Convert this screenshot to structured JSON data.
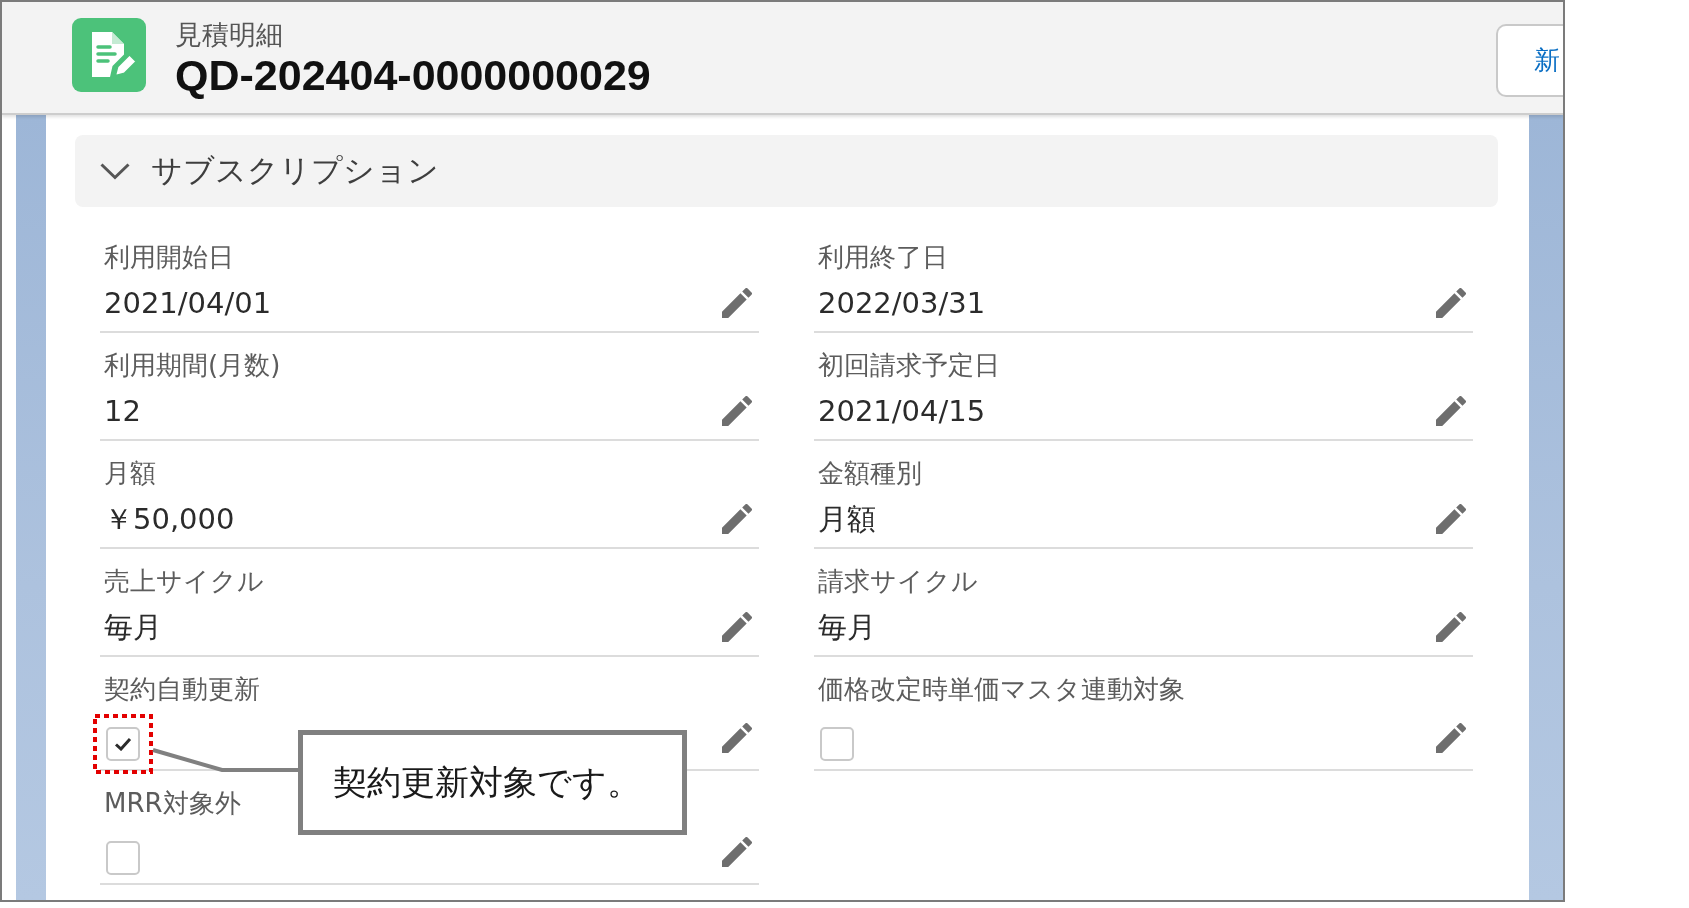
{
  "header": {
    "object_label": "見積明細",
    "record_name": "QD-202404-0000000029",
    "button": {
      "label": "新"
    }
  },
  "section": {
    "title": "サブスクリプション",
    "expanded": true,
    "fields": [
      {
        "kind": "text",
        "label": "利用開始日",
        "value": "2021/04/01",
        "highlighted": false
      },
      {
        "kind": "text",
        "label": "利用終了日",
        "value": "2022/03/31",
        "highlighted": false
      },
      {
        "kind": "text",
        "label": "利用期間(月数)",
        "value": "12",
        "highlighted": false
      },
      {
        "kind": "text",
        "label": "初回請求予定日",
        "value": "2021/04/15",
        "highlighted": false
      },
      {
        "kind": "text",
        "label": "月額",
        "value": "￥50,000",
        "highlighted": false
      },
      {
        "kind": "text",
        "label": "金額種別",
        "value": "月額",
        "highlighted": false
      },
      {
        "kind": "text",
        "label": "売上サイクル",
        "value": "毎月",
        "highlighted": false
      },
      {
        "kind": "text",
        "label": "請求サイクル",
        "value": "毎月",
        "highlighted": false
      },
      {
        "kind": "checkbox",
        "label": "契約自動更新",
        "checked": true,
        "highlighted": true
      },
      {
        "kind": "checkbox",
        "label": "価格改定時単価マスタ連動対象",
        "checked": false,
        "highlighted": false
      },
      {
        "kind": "checkbox",
        "label": "MRR対象外",
        "checked": false,
        "highlighted": false
      }
    ]
  },
  "callout": {
    "text": "契約更新対象です。"
  }
}
